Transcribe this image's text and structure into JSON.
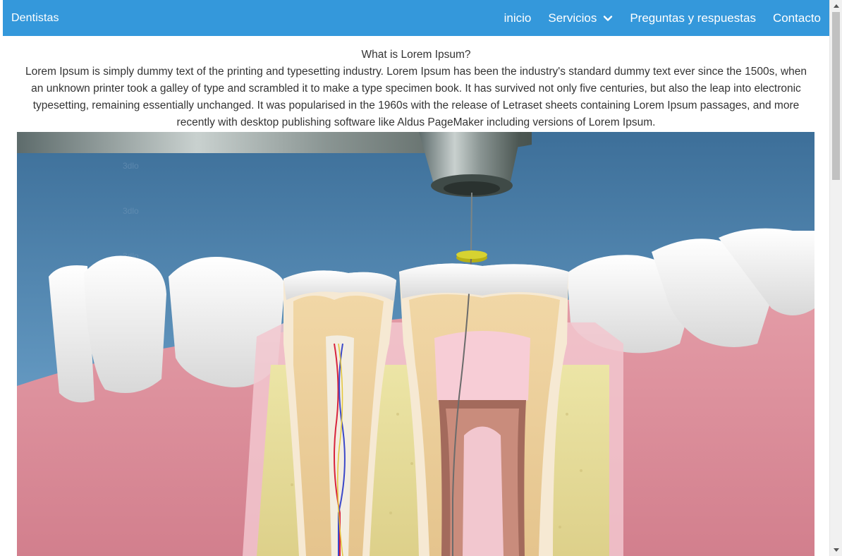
{
  "navbar": {
    "brand": "Dentistas",
    "items": [
      {
        "label": "inicio"
      },
      {
        "label": "Servicios",
        "has_dropdown": true
      },
      {
        "label": "Preguntas y respuestas"
      },
      {
        "label": "Contacto"
      }
    ],
    "bg_color": "#3498db"
  },
  "content": {
    "title": "What is Lorem Ipsum?",
    "paragraph": "Lorem Ipsum is simply dummy text of the printing and typesetting industry. Lorem Ipsum has been the industry's standard dummy text ever since the 1500s, when an unknown printer took a galley of type and scrambled it to make a type specimen book. It has survived not only five centuries, but also the leap into electronic typesetting, remaining essentially unchanged. It was popularised in the 1960s with the release of Letraset sheets containing Lorem Ipsum passages, and more recently with desktop publishing software like Aldus PageMaker including versions of Lorem Ipsum."
  },
  "hero_image": {
    "subject": "root-canal-illustration"
  },
  "icons": {
    "dropdown": "chevron-down-icon",
    "scroll_up": "arrow-up-icon",
    "scroll_down": "arrow-down-icon"
  }
}
